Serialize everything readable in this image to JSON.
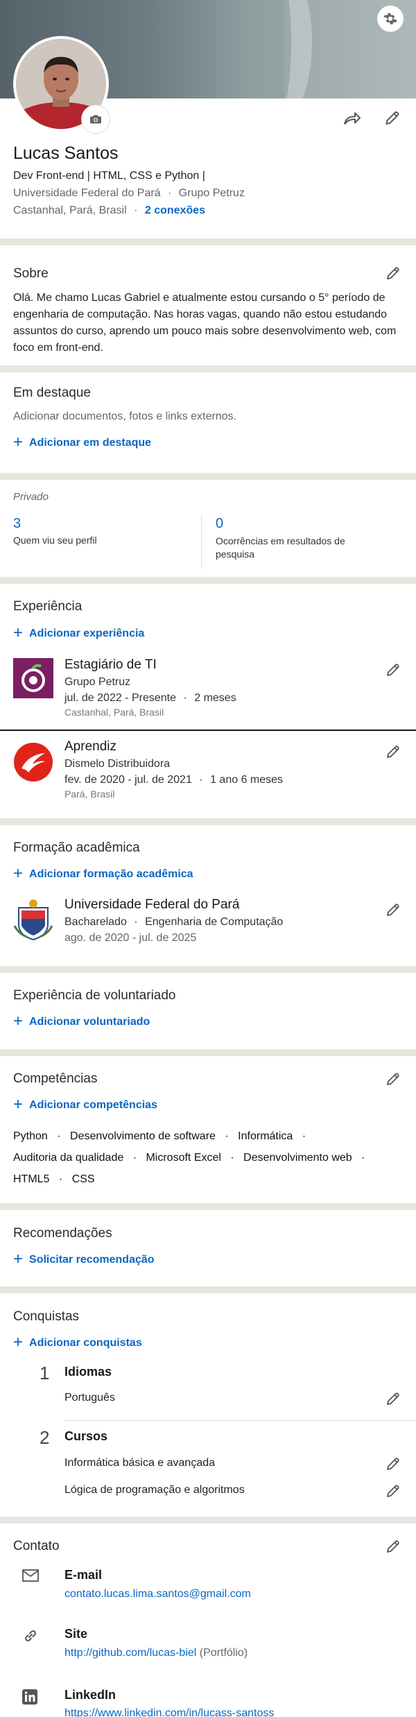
{
  "profile": {
    "name": "Lucas Santos",
    "headline": "Dev Front-end | HTML, CSS e Python |",
    "education": "Universidade Federal do Pará",
    "company": "Grupo Petruz",
    "location": "Castanhal, Pará, Brasil",
    "connections": "2 conexões",
    "dot": "·"
  },
  "about": {
    "title": "Sobre",
    "text": "Olá. Me chamo Lucas Gabriel e atualmente estou cursando o 5° período de engenharia de computação. Nas horas vagas, quando não estou estudando assuntos do curso, aprendo um pouco mais sobre desenvolvimento web, com foco em front-end."
  },
  "featured": {
    "title": "Em destaque",
    "desc": "Adicionar documentos, fotos e links externos.",
    "add": "Adicionar em destaque"
  },
  "analytics": {
    "label": "Privado",
    "views_count": "3",
    "views_label": "Quem viu seu perfil",
    "search_count": "0",
    "search_label": "Ocorrências em resultados de pesquisa"
  },
  "experience": {
    "title": "Experiência",
    "add": "Adicionar experiência",
    "items": [
      {
        "title": "Estagiário de TI",
        "company": "Grupo Petruz",
        "dates": "jul. de 2022 - Presente",
        "duration": "2 meses",
        "location": "Castanhal, Pará, Brasil"
      },
      {
        "title": "Aprendiz",
        "company": "Dismelo Distribuidora",
        "dates": "fev. de 2020 - jul. de 2021",
        "duration": "1 ano 6 meses",
        "location": "Pará, Brasil"
      }
    ]
  },
  "education": {
    "title": "Formação acadêmica",
    "add": "Adicionar formação acadêmica",
    "school": "Universidade Federal do Pará",
    "degree": "Bacharelado",
    "field": "Engenharia de Computação",
    "dates": "ago. de 2020 - jul. de 2025"
  },
  "volunteer": {
    "title": "Experiência de voluntariado",
    "add": "Adicionar voluntariado"
  },
  "skills": {
    "title": "Competências",
    "add": "Adicionar competências",
    "list": [
      "Python",
      "Desenvolvimento de software",
      "Informática",
      "Auditoria da qualidade",
      "Microsoft Excel",
      "Desenvolvimento web",
      "HTML5",
      "CSS"
    ]
  },
  "recommendations": {
    "title": "Recomendações",
    "add": "Solicitar recomendação"
  },
  "accomplishments": {
    "title": "Conquistas",
    "add": "Adicionar conquistas",
    "groups": [
      {
        "count": "1",
        "name": "Idiomas",
        "items": [
          "Português"
        ]
      },
      {
        "count": "2",
        "name": "Cursos",
        "items": [
          "Informática básica e avançada",
          "Lógica de programação e algoritmos"
        ]
      }
    ]
  },
  "contact": {
    "title": "Contato",
    "email_label": "E-mail",
    "email": "contato.lucas.lima.santos@gmail.com",
    "site_label": "Site",
    "site": "http://github.com/lucas-biel",
    "site_note": "(Portfólio)",
    "linkedin_label": "LinkedIn",
    "linkedin": "https://www.linkedin.com/in/lucass-santoss"
  },
  "colors": {
    "accent": "#0a66c2",
    "background": "#e9e5df",
    "divider": "#e9e5df"
  }
}
